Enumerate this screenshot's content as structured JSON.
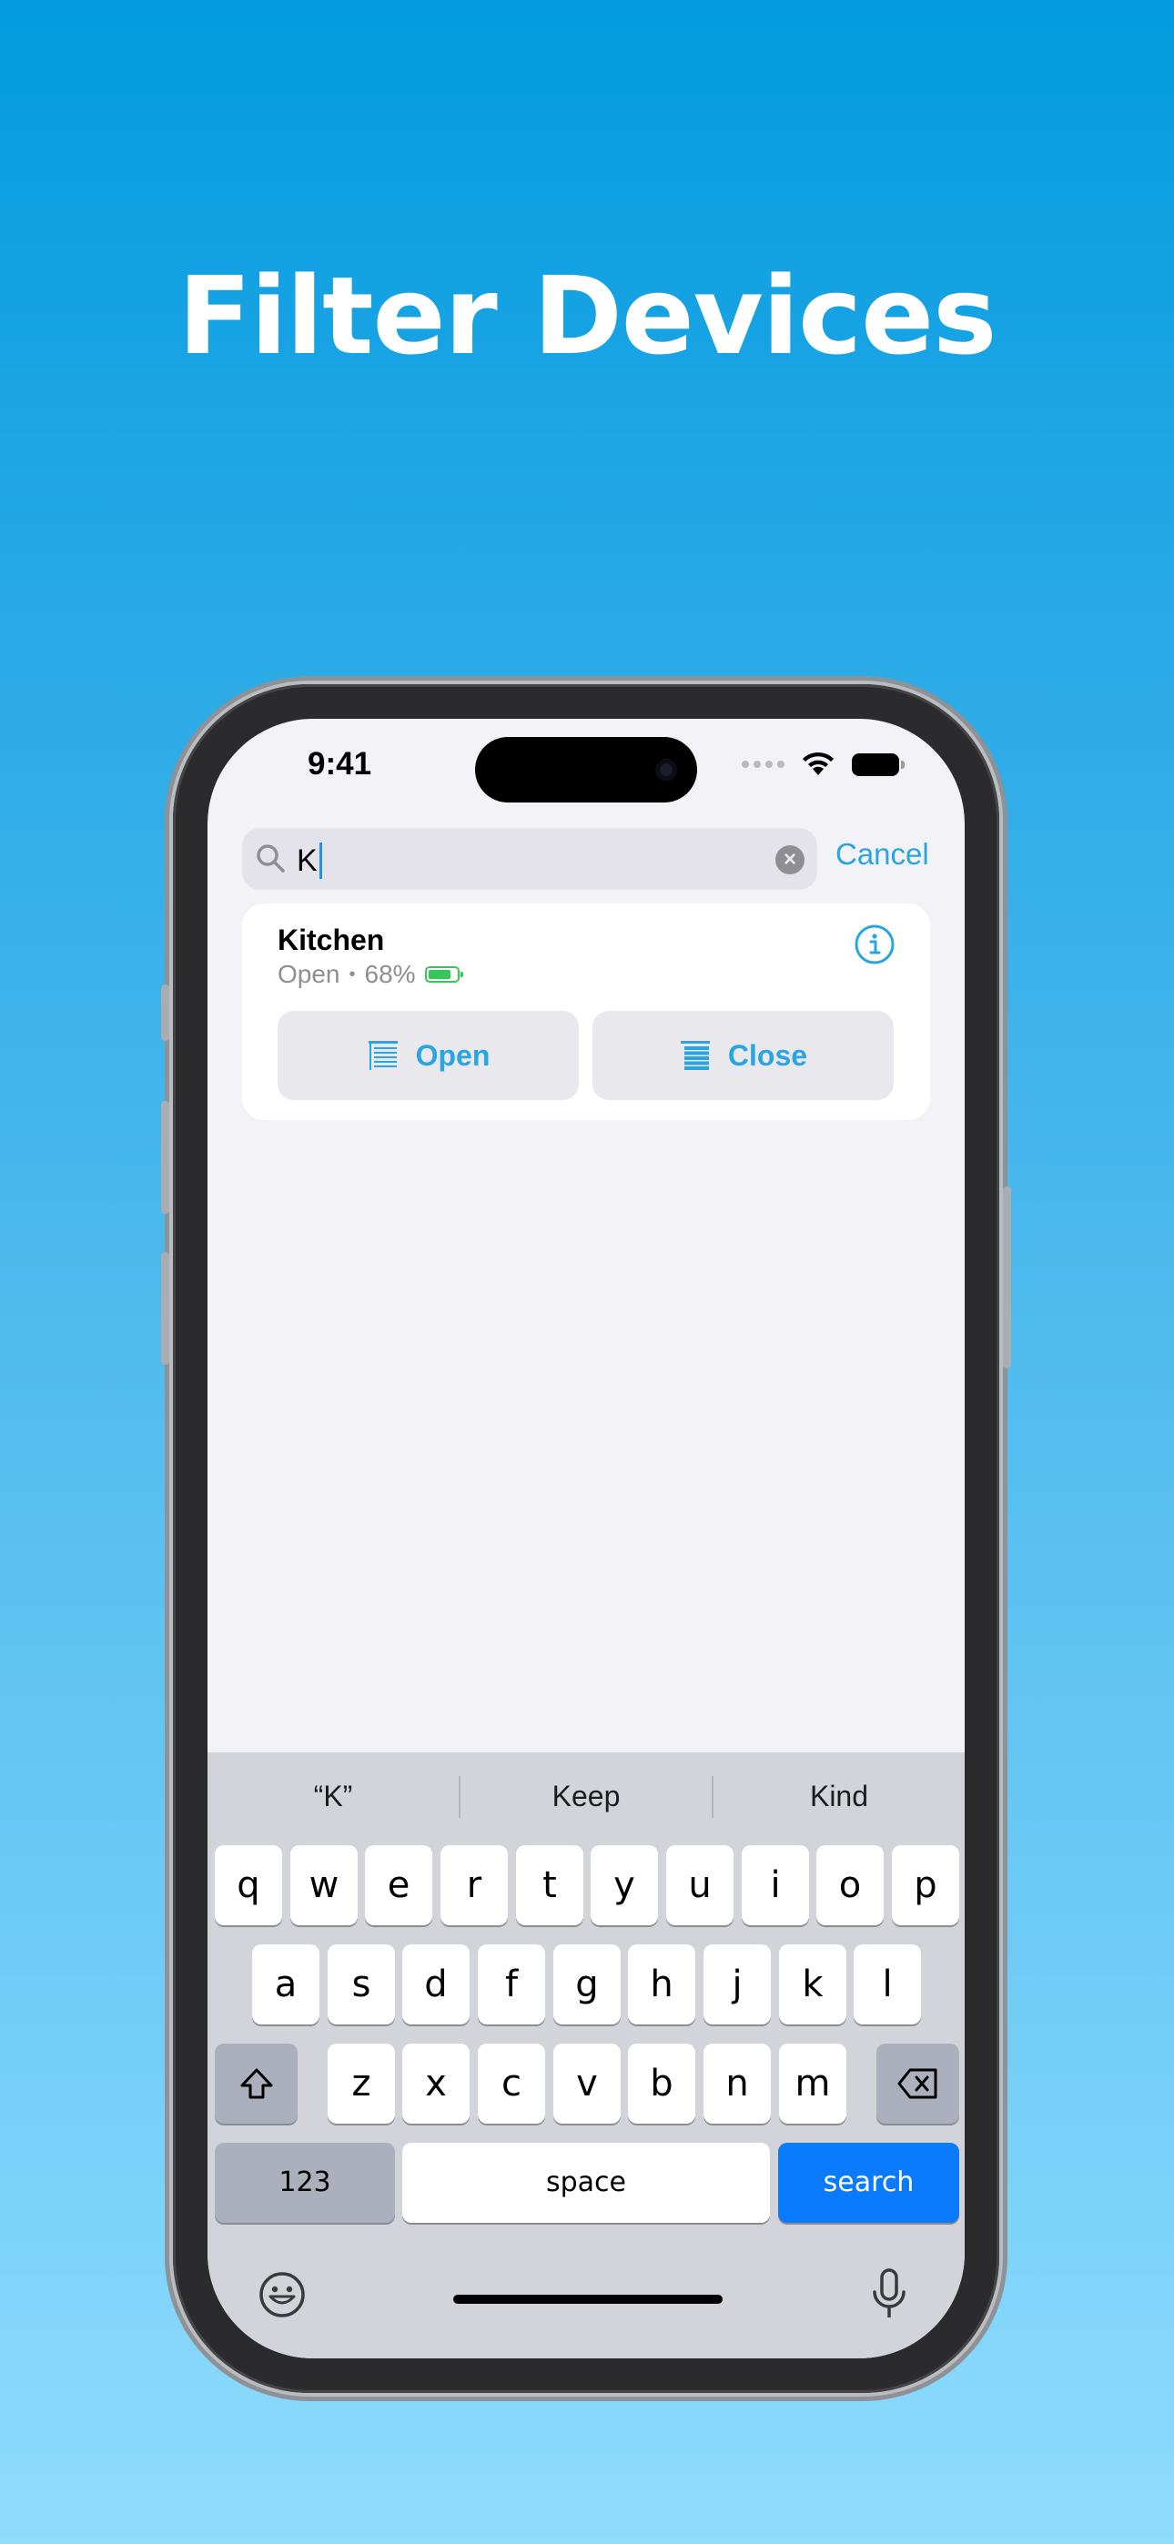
{
  "headline": "Filter Devices",
  "status_bar": {
    "time": "9:41"
  },
  "search": {
    "value": "K",
    "cancel_label": "Cancel"
  },
  "device": {
    "name": "Kitchen",
    "state": "Open",
    "separator": "•",
    "battery": "68%",
    "open_label": "Open",
    "close_label": "Close"
  },
  "keyboard": {
    "suggestions": [
      "“K”",
      "Keep",
      "Kind"
    ],
    "row1": [
      "q",
      "w",
      "e",
      "r",
      "t",
      "y",
      "u",
      "i",
      "o",
      "p"
    ],
    "row2": [
      "a",
      "s",
      "d",
      "f",
      "g",
      "h",
      "j",
      "k",
      "l"
    ],
    "row3": [
      "z",
      "x",
      "c",
      "v",
      "b",
      "n",
      "m"
    ],
    "numbers_label": "123",
    "space_label": "space",
    "search_label": "search"
  },
  "colors": {
    "accent": "#2aa5e4",
    "search_key": "#0a7aff",
    "battery_green": "#34c759"
  }
}
